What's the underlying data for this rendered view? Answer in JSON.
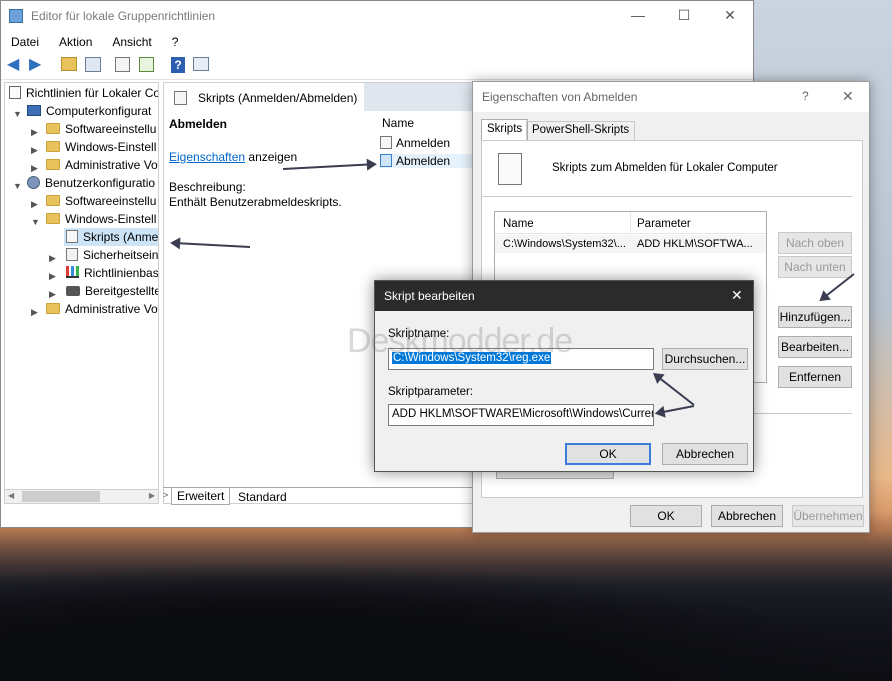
{
  "main": {
    "title": "Editor für lokale Gruppenrichtlinien",
    "controls": {
      "minimize": "—",
      "maximize": "☐",
      "close": "✕"
    },
    "menu": [
      "Datei",
      "Aktion",
      "Ansicht",
      "?"
    ],
    "tree": [
      {
        "label": "Richtlinien für Lokaler Co",
        "icon": "policy-icon"
      },
      {
        "label": "Computerkonfigurat",
        "icon": "computer-icon"
      },
      {
        "label": "Softwareeinstellu",
        "icon": "folder-icon"
      },
      {
        "label": "Windows-Einstell",
        "icon": "folder-icon"
      },
      {
        "label": "Administrative Vo",
        "icon": "folder-icon"
      },
      {
        "label": "Benutzerkonfiguratio",
        "icon": "user-icon"
      },
      {
        "label": "Softwareeinstellu",
        "icon": "folder-icon"
      },
      {
        "label": "Windows-Einstell",
        "icon": "folder-icon"
      },
      {
        "label": "Skripts (Anmel",
        "icon": "script-icon"
      },
      {
        "label": "Sicherheitsein",
        "icon": "security-icon"
      },
      {
        "label": "Richtlinienbas",
        "icon": "chart-icon"
      },
      {
        "label": "Bereitgestellte",
        "icon": "printer-icon"
      },
      {
        "label": "Administrative Vo",
        "icon": "folder-icon"
      }
    ],
    "panel_header": "Skripts (Anmelden/Abmelden)",
    "section_title": "Abmelden",
    "properties_link": "Eigenschaften",
    "properties_suffix": "anzeigen",
    "description_label": "Beschreibung:",
    "description": "Enthält Benutzerabmeldeskripts.",
    "column_name": "Name",
    "list": [
      "Anmelden",
      "Abmelden"
    ],
    "tabs": [
      "Erweitert",
      "Standard"
    ]
  },
  "props": {
    "title": "Eigenschaften von Abmelden",
    "help": "?",
    "close": "✕",
    "tabs": [
      "Skripts",
      "PowerShell-Skripts"
    ],
    "heading": "Skripts zum Abmelden für Lokaler Computer",
    "columns": [
      "Name",
      "Parameter"
    ],
    "row": [
      "C:\\Windows\\System32\\...",
      "ADD HKLM\\SOFTWA..."
    ],
    "buttons": {
      "up": "Nach oben",
      "down": "Nach unten",
      "add": "Hinzufügen...",
      "edit": "Bearbeiten...",
      "remove": "Entfernen"
    },
    "footer": {
      "ok": "OK",
      "cancel": "Abbrechen",
      "apply": "Übernehmen"
    }
  },
  "edit": {
    "title": "Skript bearbeiten",
    "close": "✕",
    "name_label": "Skriptname:",
    "name_value": "C:\\Windows\\System32\\reg.exe",
    "browse": "Durchsuchen...",
    "param_label": "Skriptparameter:",
    "param_value": "ADD HKLM\\SOFTWARE\\Microsoft\\Windows\\CurrentV",
    "ok": "OK",
    "cancel": "Abbrechen"
  },
  "watermark": "Deskmodder.de",
  "colors": {
    "accent": "#0078d7",
    "link": "#0066cc",
    "arrow": "#3a3d4f"
  }
}
